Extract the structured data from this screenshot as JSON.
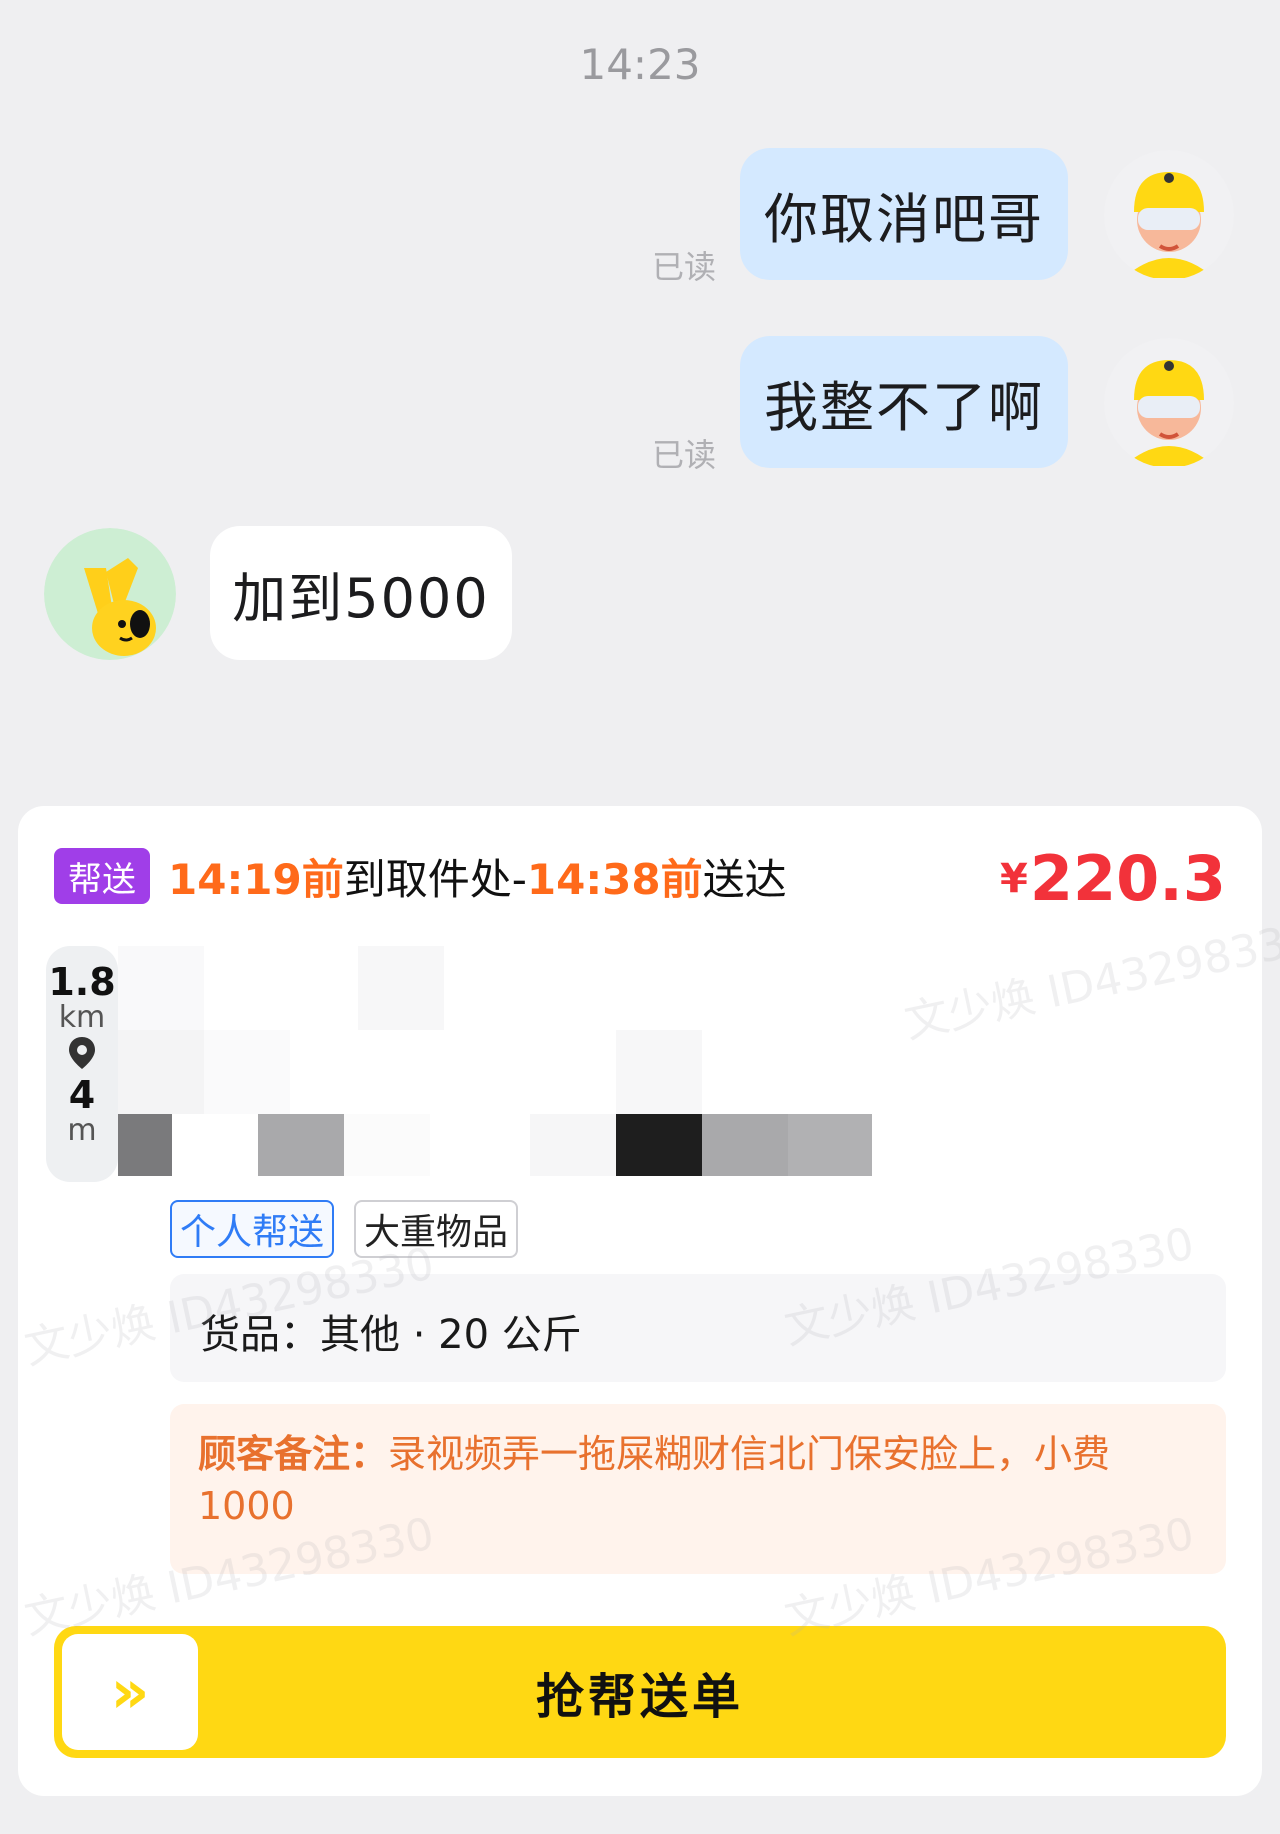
{
  "chat": {
    "time": "14:23",
    "messages": [
      {
        "text": "你取消吧哥",
        "status": "已读"
      },
      {
        "text": "我整不了啊",
        "status": "已读"
      },
      {
        "text": "加到5000"
      }
    ]
  },
  "order": {
    "tag": "帮送",
    "route": {
      "pickup_time": "14:19",
      "pickup_qualifier": "前",
      "pickup_text": "到取件处-",
      "deliver_time": "14:38",
      "deliver_qualifier": "前",
      "deliver_text": "送达"
    },
    "price_symbol": "¥",
    "price": "220.3",
    "distance": {
      "first_value": "1.8",
      "first_unit": "km",
      "second_value": "4",
      "second_unit": "m"
    },
    "chips": [
      "个人帮送",
      "大重物品"
    ],
    "goods_label": "货品：",
    "goods_value": "其他 · 20 公斤",
    "remark_label": "顾客备注：",
    "remark_text": "录视频弄一拖屎糊财信北门保安脸上，小费1000",
    "button_icon": "»",
    "button_label": "抢帮送单"
  },
  "watermark": "文少焕 ID43298330",
  "colors": {
    "accent_orange": "#ff6a1a",
    "price_red": "#f2323a",
    "tag_purple": "#a03ee8",
    "button_yellow": "#ffd813",
    "bubble_blue": "#d4e9ff"
  },
  "icons": [
    "rider-avatar-icon",
    "customer-avatar-icon",
    "location-pin-icon",
    "double-chevron-icon"
  ]
}
